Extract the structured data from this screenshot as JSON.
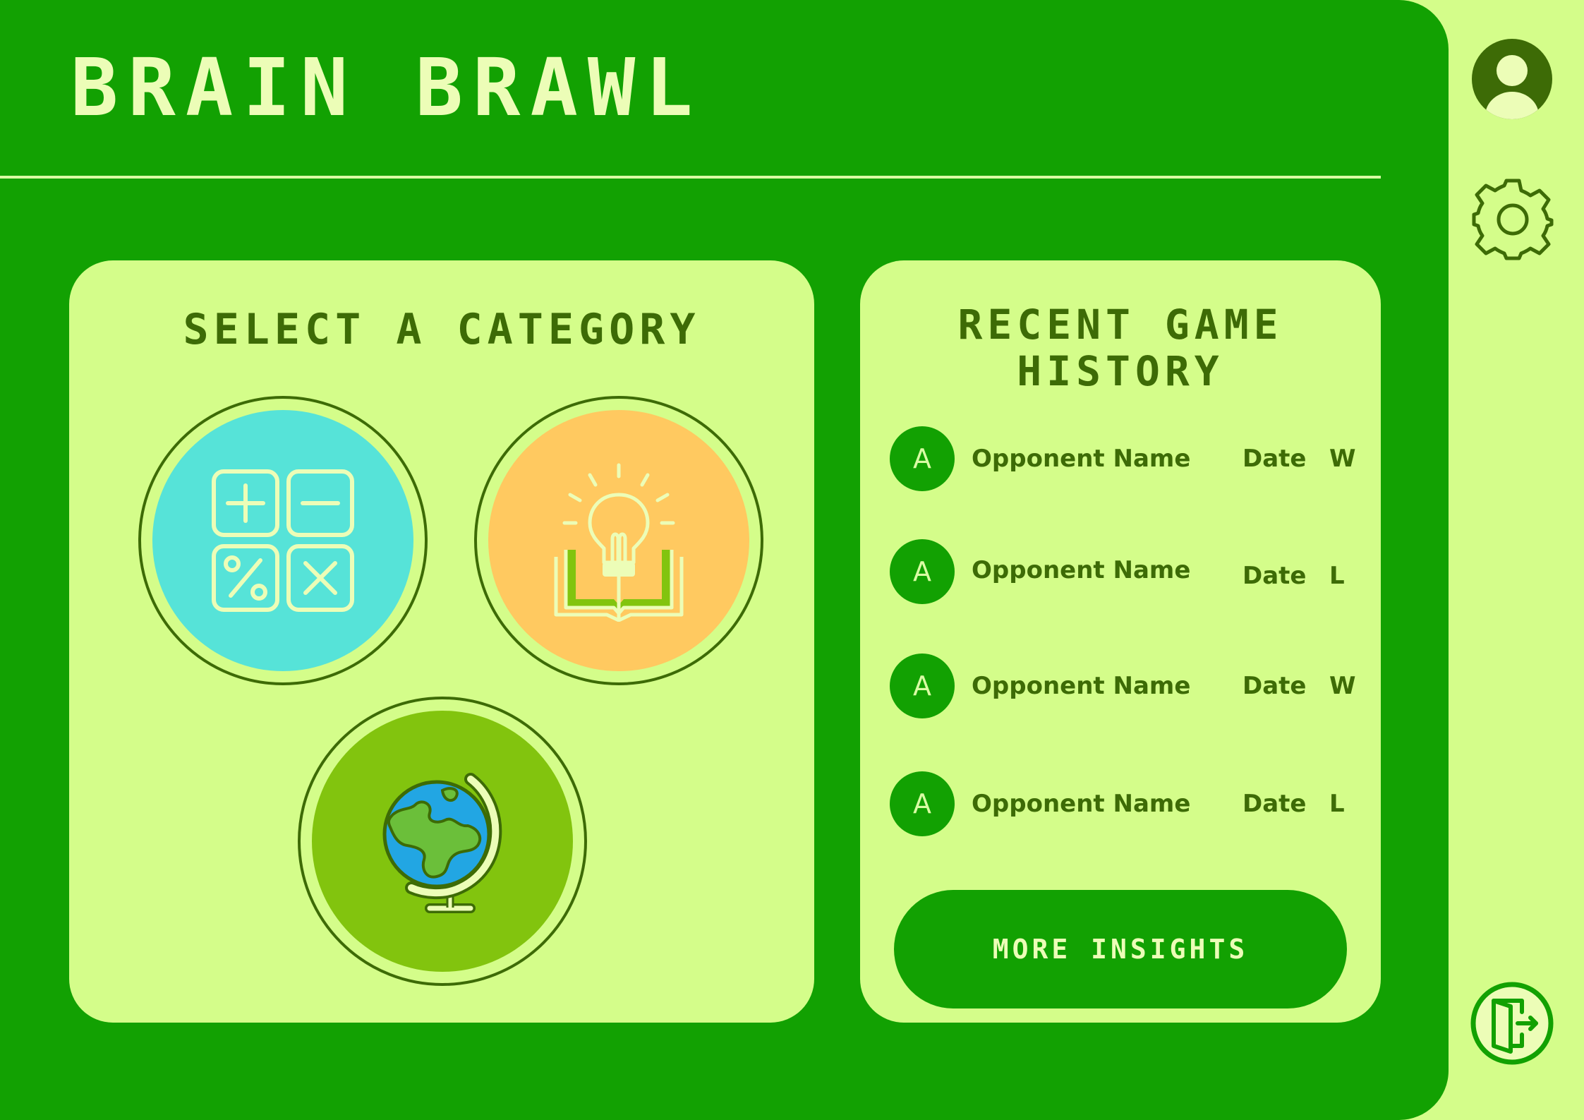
{
  "app": {
    "title": "BRAIN BRAWL"
  },
  "categories": {
    "title": "SELECT A CATEGORY",
    "items": [
      {
        "id": "math",
        "icon": "calculator-icon",
        "color": "#56e3d8"
      },
      {
        "id": "knowledge",
        "icon": "lightbulb-book-icon",
        "color": "#ffc960"
      },
      {
        "id": "geography",
        "icon": "globe-icon",
        "color": "#82c40e"
      }
    ]
  },
  "history": {
    "title": "RECENT GAME HISTORY",
    "rows": [
      {
        "avatar": "A",
        "name": "Opponent Name",
        "date": "Date",
        "result": "W"
      },
      {
        "avatar": "A",
        "name": "Opponent Name",
        "date": "Date",
        "result": "L"
      },
      {
        "avatar": "A",
        "name": "Opponent Name",
        "date": "Date",
        "result": "W"
      },
      {
        "avatar": "A",
        "name": "Opponent Name",
        "date": "Date",
        "result": "L"
      }
    ],
    "more_label": "MORE INSIGHTS"
  },
  "sidebar": {
    "icons": [
      "user-profile-icon",
      "settings-gear-icon",
      "exit-door-icon"
    ]
  },
  "colors": {
    "main_green": "#12a102",
    "light_green": "#d4fd8a",
    "dark_text": "#3d6b06",
    "title_text": "#ecfdb7"
  }
}
